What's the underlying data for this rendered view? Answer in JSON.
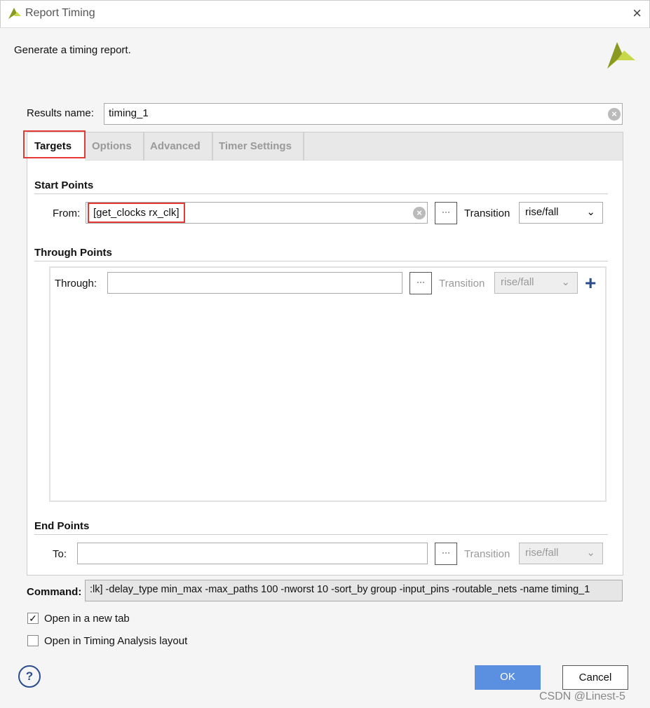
{
  "window": {
    "title": "Report Timing",
    "close_icon": "×"
  },
  "subtitle": "Generate a timing report.",
  "results": {
    "label": "Results name:",
    "value": "timing_1"
  },
  "tabs": [
    {
      "label": "Targets"
    },
    {
      "label": "Options"
    },
    {
      "label": "Advanced"
    },
    {
      "label": "Timer Settings"
    }
  ],
  "start": {
    "heading": "Start Points",
    "label": "From:",
    "value": "[get_clocks rx_clk]",
    "transition_label": "Transition",
    "transition": "rise/fall"
  },
  "through": {
    "heading": "Through Points",
    "label": "Through:",
    "value": "",
    "transition_label": "Transition",
    "transition": "rise/fall",
    "add": "+"
  },
  "end": {
    "heading": "End Points",
    "label": "To:",
    "value": "",
    "transition_label": "Transition",
    "transition": "rise/fall"
  },
  "browse": "···",
  "command": {
    "label": "Command:",
    "value": ":lk] -delay_type min_max -max_paths 100 -nworst 10 -sort_by group -input_pins -routable_nets -name timing_1"
  },
  "options": [
    {
      "label": "Open in a new tab",
      "checked": true
    },
    {
      "label": "Open in Timing Analysis layout",
      "checked": false
    }
  ],
  "buttons": {
    "help": "?",
    "ok": "OK",
    "cancel": "Cancel"
  },
  "watermark": "CSDN @Linest-5",
  "colors": {
    "accent": "#5b8fe0",
    "highlight": "#e53935",
    "plus": "#2a4d8f"
  }
}
